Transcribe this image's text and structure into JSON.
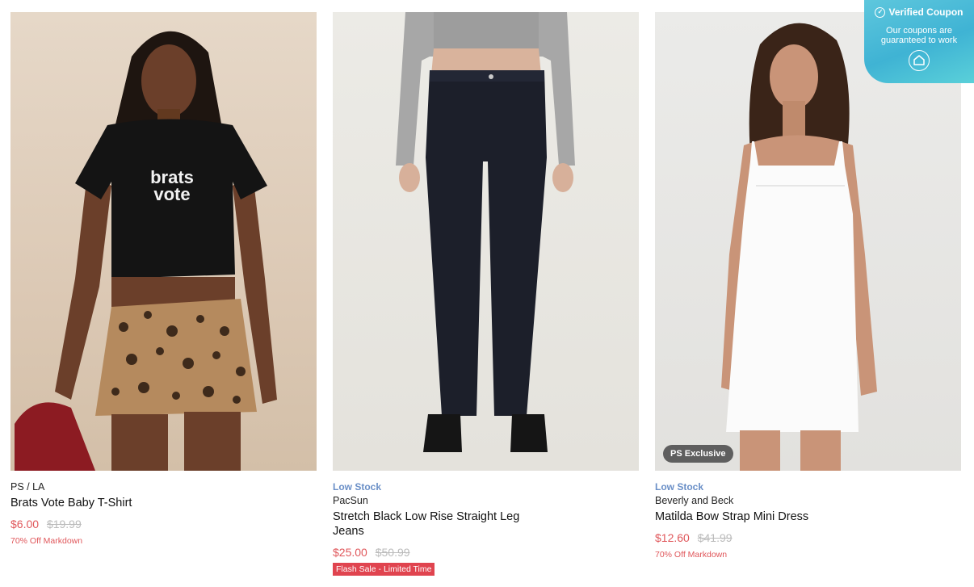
{
  "products": [
    {
      "stock_label": "",
      "brand": "PS / LA",
      "title": "Brats Vote Baby T-Shirt",
      "price": "$6.00",
      "was_price": "$19.99",
      "note": "70% Off Markdown",
      "shirt_text": "brats vote"
    },
    {
      "stock_label": "Low Stock",
      "brand": "PacSun",
      "title": "Stretch Black Low Rise Straight Leg Jeans",
      "price": "$25.00",
      "was_price": "$50.99",
      "flash_label": "Flash Sale - Limited Time"
    },
    {
      "stock_label": "Low Stock",
      "brand": "Beverly and Beck",
      "title": "Matilda Bow Strap Mini Dress",
      "price": "$12.60",
      "was_price": "$41.99",
      "note": "70% Off Markdown",
      "badge": "PS Exclusive"
    }
  ],
  "coupon": {
    "title": "Verified Coupon",
    "subtitle": "Our coupons are guaranteed to work",
    "icon": "coupon-tag-icon"
  },
  "colors": {
    "sale_red": "#e0575b",
    "low_stock_blue": "#6a8fc7",
    "coupon_teal": "#3fb3d4"
  }
}
